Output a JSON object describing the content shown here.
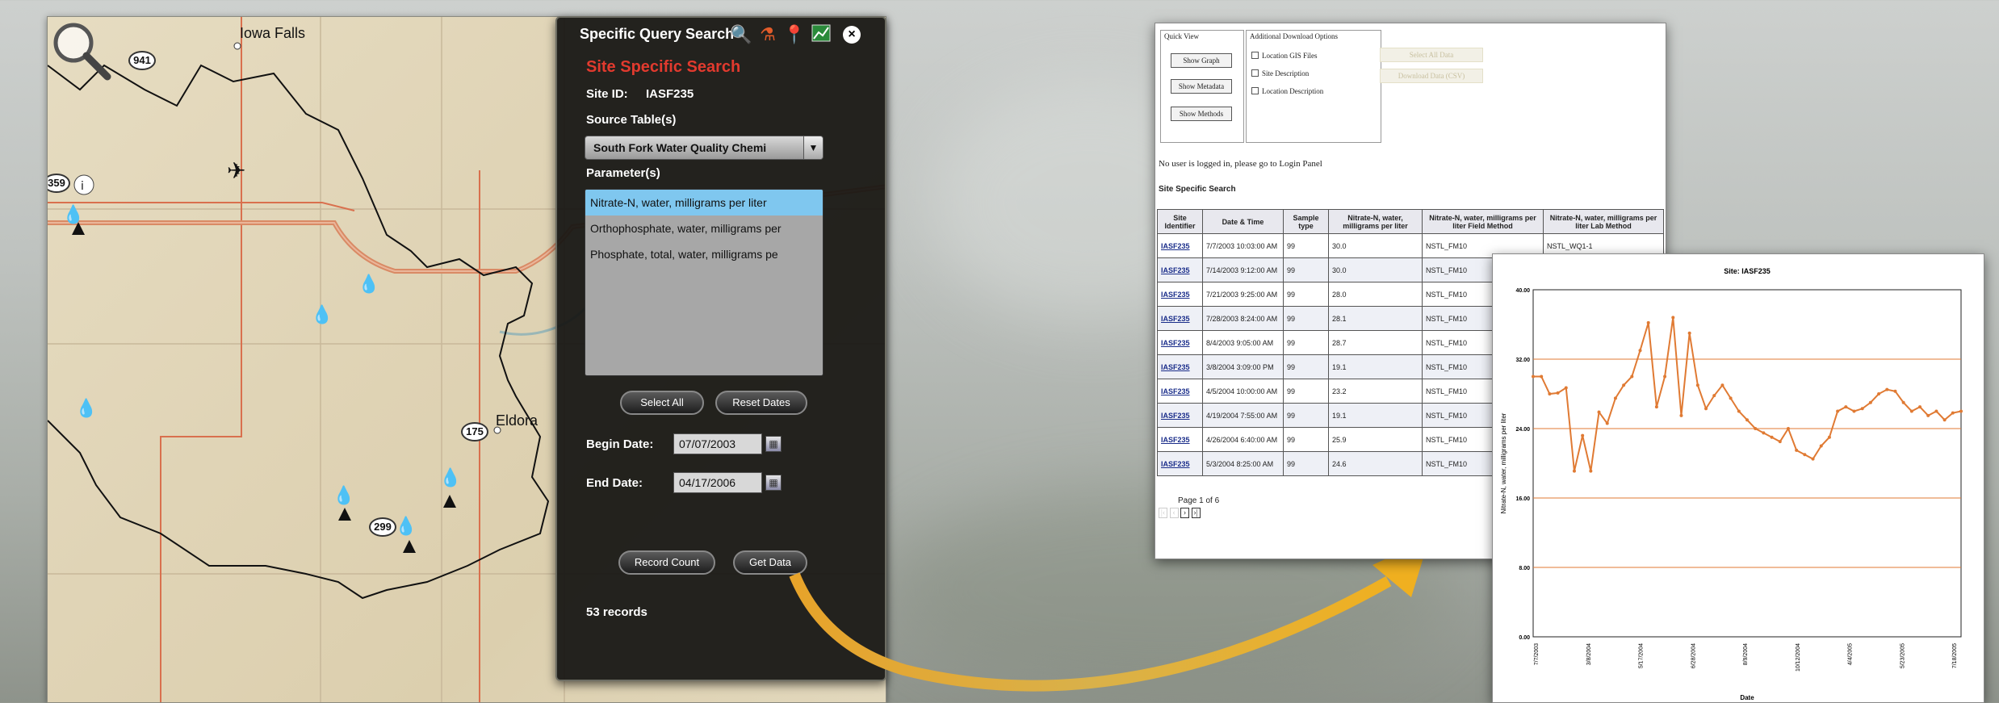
{
  "map": {
    "place_labels": [
      "Iowa Falls",
      "Eldora"
    ],
    "route_shields": [
      "941",
      "175",
      "299",
      "359"
    ]
  },
  "panel": {
    "title": "Specific Query Search",
    "tool_icons": [
      "search-icon",
      "flask-icon",
      "map-pin-icon",
      "chart-icon",
      "close-icon"
    ],
    "heading": "Site Specific Search",
    "site_id_label": "Site ID:",
    "site_id_value": "IASF235",
    "source_label": "Source Table(s)",
    "source_value": "South Fork Water Quality Chemi",
    "parameter_label": "Parameter(s)",
    "parameters": [
      "Nitrate-N, water, milligrams per liter",
      "Orthophosphate, water, milligrams per",
      "Phosphate, total, water, milligrams pe"
    ],
    "select_all": "Select All",
    "reset_dates": "Reset Dates",
    "begin_label": "Begin Date:",
    "begin_value": "07/07/2003",
    "end_label": "End Date:",
    "end_value": "04/17/2006",
    "record_count": "Record Count",
    "get_data": "Get Data",
    "records": "53 records"
  },
  "results_page": {
    "quick_view": "Quick View",
    "show_graph": "Show Graph",
    "show_metadata": "Show Metadata",
    "show_methods": "Show Methods",
    "additional_options": "Additional Download Options",
    "options": [
      "Location GIS Files",
      "Site Description",
      "Location Description"
    ],
    "ghost_buttons": [
      "Select All Data",
      "Download Data (CSV)"
    ],
    "login_notice": "No user is logged in, please go to Login Panel",
    "section_title": "Site Specific Search",
    "columns": [
      "Site Identifier",
      "Date & Time",
      "Sample type",
      "Nitrate-N, water, milligrams per liter",
      "Nitrate-N, water, milligrams per liter Field Method",
      "Nitrate-N, water, milligrams per liter Lab Method"
    ],
    "rows": [
      [
        "IASF235",
        "7/7/2003 10:03:00 AM",
        "99",
        "30.0",
        "NSTL_FM10",
        "NSTL_WQ1-1"
      ],
      [
        "IASF235",
        "7/14/2003 9:12:00 AM",
        "99",
        "30.0",
        "NSTL_FM10",
        ""
      ],
      [
        "IASF235",
        "7/21/2003 9:25:00 AM",
        "99",
        "28.0",
        "NSTL_FM10",
        ""
      ],
      [
        "IASF235",
        "7/28/2003 8:24:00 AM",
        "99",
        "28.1",
        "NSTL_FM10",
        ""
      ],
      [
        "IASF235",
        "8/4/2003 9:05:00 AM",
        "99",
        "28.7",
        "NSTL_FM10",
        ""
      ],
      [
        "IASF235",
        "3/8/2004 3:09:00 PM",
        "99",
        "19.1",
        "NSTL_FM10",
        ""
      ],
      [
        "IASF235",
        "4/5/2004 10:00:00 AM",
        "99",
        "23.2",
        "NSTL_FM10",
        ""
      ],
      [
        "IASF235",
        "4/19/2004 7:55:00 AM",
        "99",
        "19.1",
        "NSTL_FM10",
        ""
      ],
      [
        "IASF235",
        "4/26/2004 6:40:00 AM",
        "99",
        "25.9",
        "NSTL_FM10",
        ""
      ],
      [
        "IASF235",
        "5/3/2004 8:25:00 AM",
        "99",
        "24.6",
        "NSTL_FM10",
        ""
      ]
    ],
    "pager": "Page 1 of 6"
  },
  "chart_data": {
    "type": "line",
    "title": "Site: IASF235",
    "xlabel": "Date",
    "ylabel": "Nitrate-N, water, milligrams per liter",
    "ylim": [
      0,
      40
    ],
    "yticks": [
      "0.00",
      "8.00",
      "16.00",
      "24.00",
      "32.00",
      "40.00"
    ],
    "xticks": [
      "7/7/2003",
      "3/8/2004",
      "5/17/2004",
      "6/28/2004",
      "8/9/2004",
      "10/12/2004",
      "4/4/2005",
      "5/23/2005",
      "7/18/2005"
    ],
    "grid": true,
    "color": "#e07a33",
    "series": [
      {
        "values": [
          30.0,
          30.0,
          28.0,
          28.1,
          28.7,
          19.1,
          23.2,
          19.1,
          25.9,
          24.6,
          27.5,
          29.0,
          30.0,
          33.0,
          36.2,
          26.5,
          30.0,
          36.8,
          25.5,
          35.0,
          29.0,
          26.3,
          27.8,
          29.0,
          27.5,
          26.0,
          25.0,
          24.0,
          23.5,
          23.0,
          22.5,
          24.0,
          21.5,
          21.0,
          20.5,
          22.0,
          23.0,
          26.0,
          26.5,
          26.0,
          26.3,
          27.0,
          28.0,
          28.5,
          28.3,
          27.0,
          26.0,
          26.5,
          25.5,
          26.0,
          25.0,
          25.8,
          26.0
        ]
      }
    ]
  },
  "arrow_color": "#e7a32a"
}
